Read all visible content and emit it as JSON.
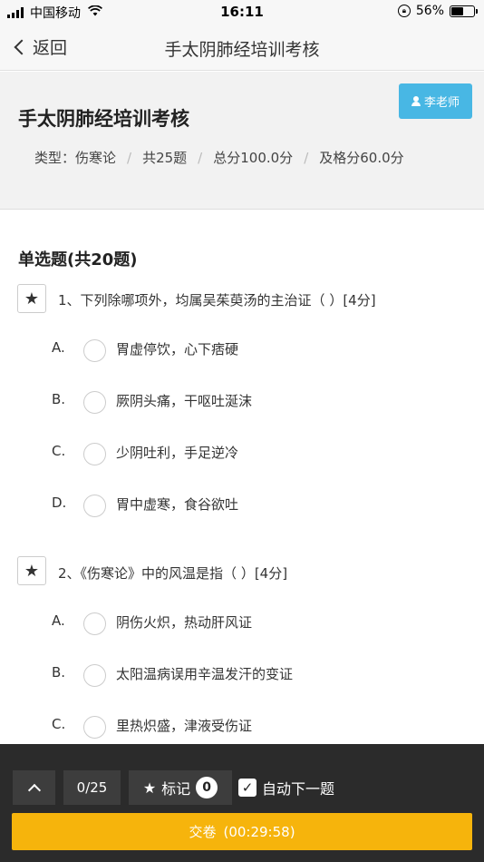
{
  "status_bar": {
    "carrier": "中国移动",
    "time": "16:11",
    "battery": "56%",
    "battery_level": 0.56,
    "wifi_icon": "wifi-icon",
    "rotation_lock_icon": "rotation-lock-icon"
  },
  "nav": {
    "back_label": "返回",
    "title": "手太阴肺经培训考核"
  },
  "exam": {
    "title": "手太阴肺经培训考核",
    "teacher_label": "李老师",
    "type": "类型：伤寒论",
    "total_questions": "共25题",
    "total_score": "总分100.0分",
    "pass_score": "及格分60.0分",
    "separator": "/"
  },
  "section": {
    "title": "单选题(共20题)"
  },
  "questions": [
    {
      "text": "1、下列除哪项外，均属吴茱萸汤的主治证（ ）[4分]",
      "options": [
        {
          "letter": "A.",
          "text": "胃虚停饮，心下痞硬"
        },
        {
          "letter": "B.",
          "text": "厥阴头痛，干呕吐涎沫"
        },
        {
          "letter": "C.",
          "text": "少阴吐利，手足逆冷"
        },
        {
          "letter": "D.",
          "text": "胃中虚寒，食谷欲吐"
        }
      ]
    },
    {
      "text": "2、《伤寒论》中的风温是指（ ）[4分]",
      "options": [
        {
          "letter": "A.",
          "text": "阴伤火炽，热动肝风证"
        },
        {
          "letter": "B.",
          "text": "太阳温病误用辛温发汗的变证"
        },
        {
          "letter": "C.",
          "text": "里热炽盛，津液受伤证"
        }
      ]
    }
  ],
  "bottom": {
    "progress": "0/25",
    "mark_label": "标记",
    "mark_count": "0",
    "auto_next_label": "自动下一题",
    "auto_next_checked": true,
    "submit_label": "交卷",
    "timer": "(00:29:58)",
    "accent_color": "#f6b40c"
  },
  "colors": {
    "teacher_button": "#48b7e4",
    "bottom_bar": "#2b2b2b"
  }
}
